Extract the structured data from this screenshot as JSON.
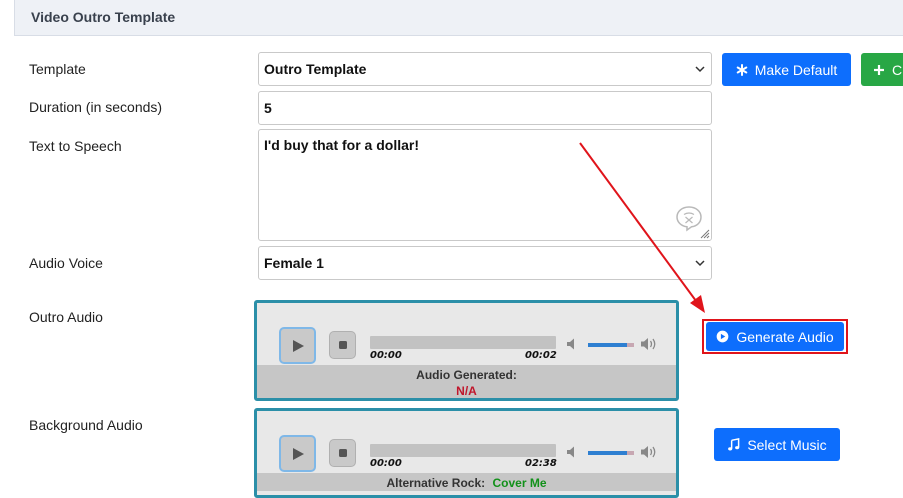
{
  "panel": {
    "title": "Video Outro Template"
  },
  "fields": {
    "template": {
      "label": "Template",
      "value": "Outro Template"
    },
    "duration": {
      "label": "Duration (in seconds)",
      "value": "5"
    },
    "tts": {
      "label": "Text to Speech",
      "value": "I'd buy that for a dollar!"
    },
    "voice": {
      "label": "Audio Voice",
      "value": "Female 1"
    },
    "outro_audio": {
      "label": "Outro Audio"
    },
    "background_audio": {
      "label": "Background Audio"
    }
  },
  "buttons": {
    "make_default": "Make Default",
    "create_partial": "C",
    "generate_audio": "Generate Audio",
    "select_music": "Select Music"
  },
  "outro_player": {
    "current_time": "00:00",
    "duration": "00:02",
    "status_label": "Audio Generated:",
    "status_value": "N/A",
    "volume": 0.85
  },
  "background_player": {
    "current_time": "00:00",
    "duration": "02:38",
    "genre": "Alternative Rock:",
    "track": "Cover Me",
    "volume": 0.85
  },
  "colors": {
    "primary": "#0d6efd",
    "success": "#28a745",
    "player_border": "#2b8fa8",
    "status_na": "#c0172c",
    "track_name": "#12911a",
    "annotation": "#e0141b"
  },
  "icons": [
    "chevron-down-icon",
    "asterisk-icon",
    "plus-icon",
    "play-circle-icon",
    "music-note-icon",
    "play-icon",
    "stop-icon",
    "speaker-icon",
    "speaker-loud-icon",
    "grammarly-icon",
    "resize-grip-icon"
  ]
}
